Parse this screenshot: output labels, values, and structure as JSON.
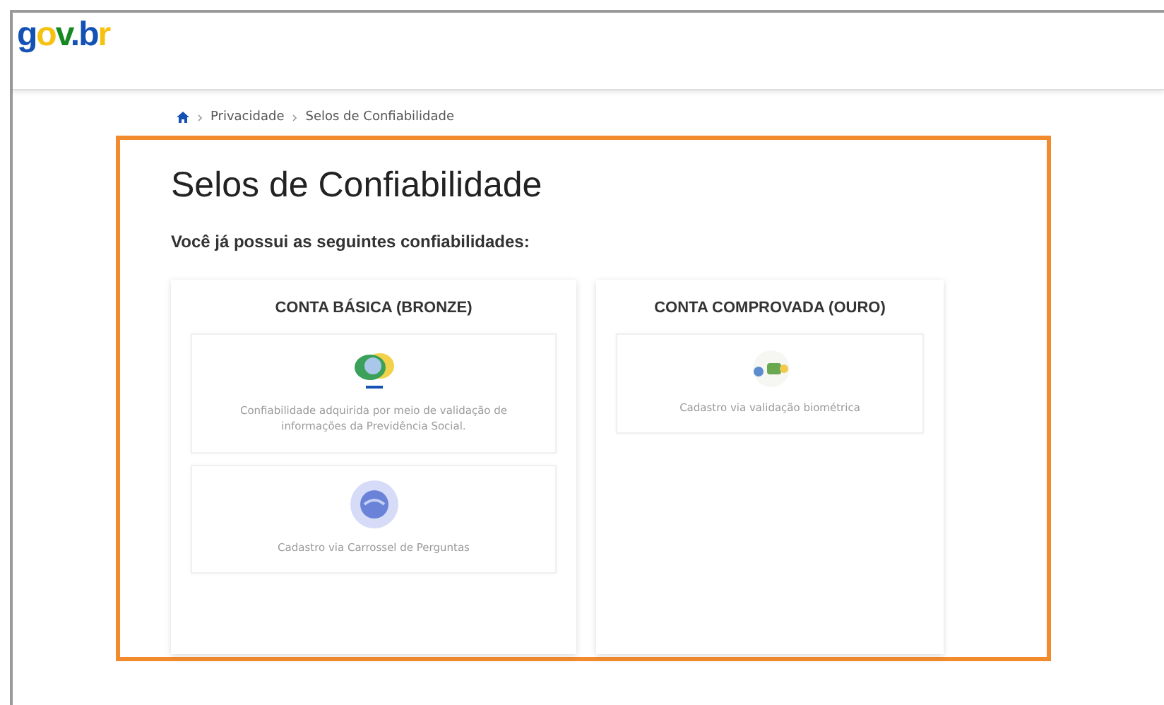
{
  "header": {
    "logo": "gov.br"
  },
  "breadcrumb": [
    "Privacidade",
    "Selos de Confiabilidade"
  ],
  "title": "Selos de Confiabilidade",
  "subtitle": "Você já possui as seguintes confiabilidades:",
  "levels": [
    {
      "title": "CONTA BÁSICA (BRONZE)",
      "seals": [
        {
          "kind": "inss",
          "text": "Confiabilidade adquirida por meio de validação de informações da Previdência Social."
        },
        {
          "kind": "questions",
          "text": "Cadastro via Carrossel de Perguntas"
        }
      ]
    },
    {
      "title": "CONTA COMPROVADA (OURO)",
      "seals": [
        {
          "kind": "biometric",
          "text": "Cadastro via validação biométrica"
        }
      ]
    }
  ]
}
